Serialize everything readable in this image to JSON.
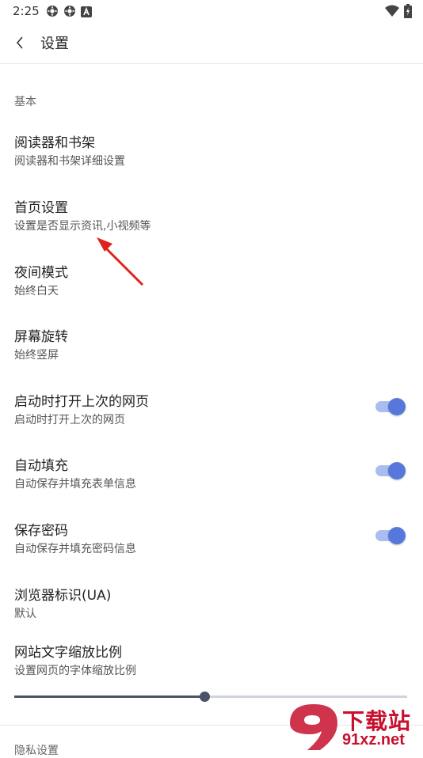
{
  "status_bar": {
    "time": "2:25",
    "left_icons": [
      "settings-cog-icon",
      "settings-cog-icon",
      "notification-a-icon"
    ],
    "right_icons": [
      "wifi-icon",
      "battery-charging-icon"
    ]
  },
  "app_bar": {
    "title": "设置",
    "back_icon": "chevron-left-icon"
  },
  "section": {
    "header": "基本"
  },
  "items": [
    {
      "title": "阅读器和书架",
      "subtitle": "阅读器和书架详细设置"
    },
    {
      "title": "首页设置",
      "subtitle": "设置是否显示资讯,小视频等"
    },
    {
      "title": "夜间模式",
      "subtitle": "始终白天"
    },
    {
      "title": "屏幕旋转",
      "subtitle": "始终竖屏"
    },
    {
      "title": "启动时打开上次的网页",
      "subtitle": "启动时打开上次的网页",
      "toggle": true
    },
    {
      "title": "自动填充",
      "subtitle": "自动保存并填充表单信息",
      "toggle": true
    },
    {
      "title": "保存密码",
      "subtitle": "自动保存并填充密码信息",
      "toggle": true
    },
    {
      "title": "浏览器标识(UA)",
      "subtitle": "默认"
    },
    {
      "title": "网站文字缩放比例",
      "subtitle": "设置网页的字体缩放比例"
    }
  ],
  "slider": {
    "value_fraction": 0.487
  },
  "next_section": {
    "header": "隐私设置"
  },
  "watermark": {
    "line1": "下载站",
    "line2": "91xz.net"
  },
  "colors": {
    "toggle_thumb": "#5677dc",
    "toggle_track": "#a9bdf0",
    "slider_active": "#4a5366",
    "annotation_arrow": "#e0201c",
    "watermark": "#c8102e"
  }
}
